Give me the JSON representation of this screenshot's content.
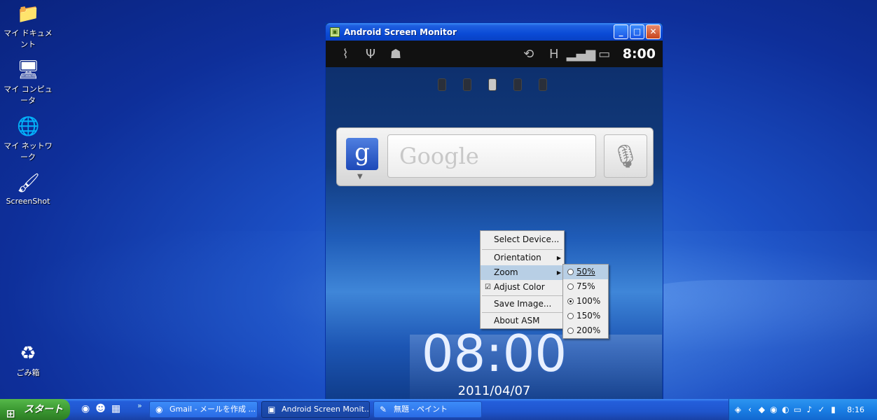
{
  "desktop": {
    "icons": [
      {
        "label": "マイ ドキュメント",
        "icon": "folder-icon"
      },
      {
        "label": "マイ コンピュータ",
        "icon": "computer-icon"
      },
      {
        "label": "マイ ネットワーク",
        "icon": "network-icon"
      },
      {
        "label": "ScreenShot",
        "icon": "screenshot-shortcut-icon"
      },
      {
        "label": "ごみ箱",
        "icon": "recycle-bin-icon"
      }
    ]
  },
  "window": {
    "title": "Android Screen Monitor",
    "buttons": {
      "minimize": "_",
      "maximize": "□",
      "close": "✕"
    }
  },
  "android": {
    "status_time": "8:00",
    "search_placeholder": "Google",
    "google_letter": "g",
    "clock": "08:00",
    "date": "2011/04/07"
  },
  "context_menu": {
    "items": [
      {
        "label": "Select Device...",
        "mnemonic": "D"
      },
      {
        "label": "Orientation",
        "mnemonic": "O"
      },
      {
        "label": "Zoom",
        "mnemonic": "Z"
      },
      {
        "label": "Adjust Color",
        "checked": true
      },
      {
        "label": "Save Image...",
        "mnemonic": "S"
      },
      {
        "label": "About ASM",
        "mnemonic": "A"
      }
    ],
    "zoom_options": [
      {
        "label": "50%",
        "selected": false
      },
      {
        "label": "75%",
        "selected": false
      },
      {
        "label": "100%",
        "selected": true
      },
      {
        "label": "150%",
        "selected": false
      },
      {
        "label": "200%",
        "selected": false
      }
    ]
  },
  "taskbar": {
    "start_label": "スタート",
    "tasks": [
      {
        "label": "Gmail - メールを作成 ...",
        "icon": "chrome-icon"
      },
      {
        "label": "Android Screen Monit...",
        "icon": "asm-icon"
      },
      {
        "label": "無題 - ペイント",
        "icon": "paint-icon"
      }
    ],
    "clock": "8:16"
  }
}
